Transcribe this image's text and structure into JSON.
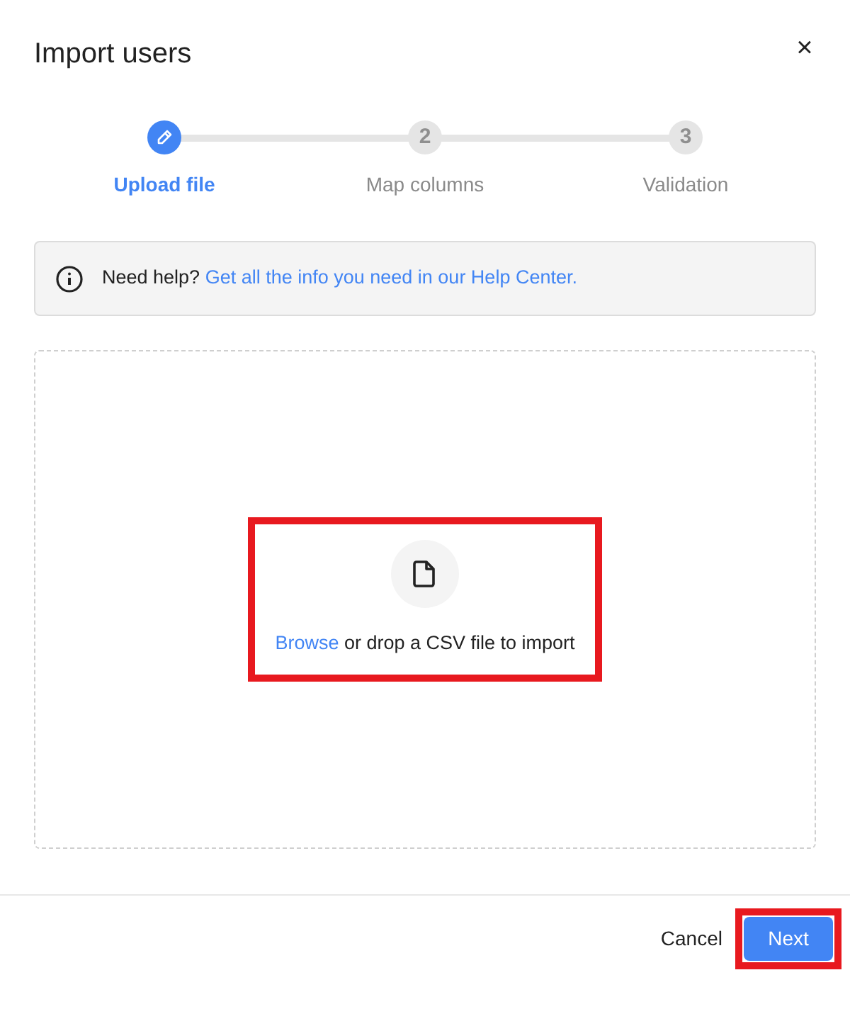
{
  "dialog": {
    "title": "Import users",
    "close": "×"
  },
  "steps": [
    {
      "label": "Upload file",
      "selected": true
    },
    {
      "label": "Map columns",
      "marker": "2",
      "selected": false
    },
    {
      "label": "Validation",
      "marker": "3",
      "selected": false
    }
  ],
  "notice": {
    "text": "Need help?",
    "link": "Get all the info you need in our Help Center."
  },
  "drop_zone": {
    "link": "Browse",
    "text": "or drop a CSV file to import",
    "highlighted": true
  },
  "footer": {
    "cancel": "Cancel",
    "next": {
      "label": "Next",
      "highlighted": true
    }
  }
}
